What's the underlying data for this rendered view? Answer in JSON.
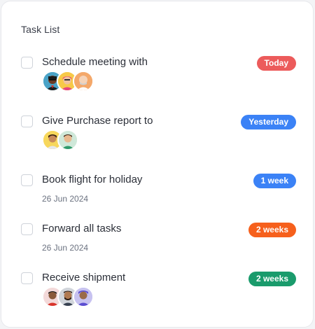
{
  "header": {
    "title": "Task List"
  },
  "colors": {
    "red": "#ec5b5b",
    "blue": "#3b82f6",
    "orange": "#f6601c",
    "green": "#1a9b6c"
  },
  "tasks": [
    {
      "label": "Schedule meeting with",
      "badge": "Today",
      "badge_color": "red",
      "avatars": [
        "avatar-dark-man",
        "avatar-pink-woman",
        "avatar-bald-man"
      ]
    },
    {
      "label": "Give Purchase report to",
      "badge": "Yesterday",
      "badge_color": "blue",
      "avatars": [
        "avatar-yellow-woman",
        "avatar-green-man"
      ]
    },
    {
      "label": "Book flight for holiday",
      "badge": "1 week",
      "badge_color": "blue",
      "date": "26 Jun 2024"
    },
    {
      "label": "Forward all tasks",
      "badge": "2 weeks",
      "badge_color": "orange",
      "date": "26 Jun 2024"
    },
    {
      "label": "Receive shipment",
      "badge": "2 weeks",
      "badge_color": "green",
      "avatars": [
        "avatar-gray-man",
        "avatar-bearded-man",
        "avatar-purple-man"
      ]
    }
  ]
}
